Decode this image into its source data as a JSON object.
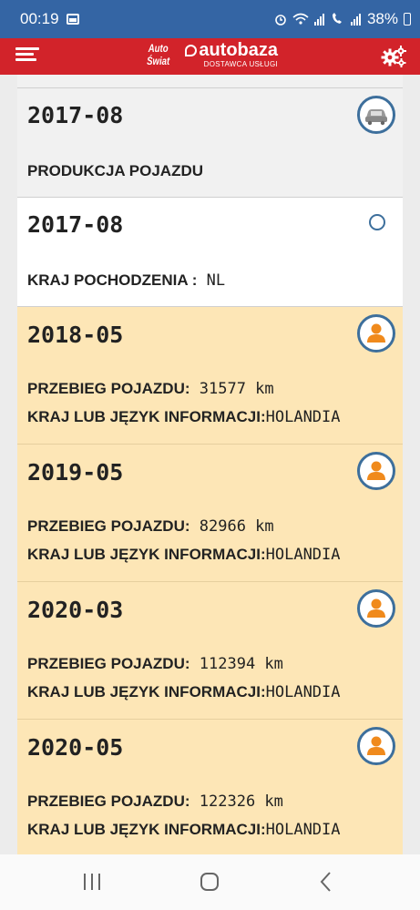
{
  "status_bar": {
    "time": "00:19",
    "battery": "38%",
    "icons": [
      "gallery-icon",
      "alarm-icon",
      "wifi-icon",
      "signal-icon",
      "wifi-call-icon",
      "signal-2-icon",
      "battery-icon"
    ]
  },
  "app_bar": {
    "logo_left_line1": "Auto",
    "logo_left_line2": "Świat",
    "logo_right_main": "autobaza",
    "logo_right_sub": "DOSTAWCA USŁUGI",
    "colors": {
      "bar": "#d2232a",
      "status": "#3465a4"
    }
  },
  "entries": [
    {
      "date": "2017-08",
      "line1_label": "PRODUKCJA POJAZDU",
      "icon": "car-icon",
      "style": "gray"
    },
    {
      "date": "2017-08",
      "line1_label": "KRAJ POCHODZENIA :",
      "line1_value": " NL",
      "icon": "dot-icon",
      "style": "white"
    },
    {
      "date": "2018-05",
      "line1_label": "PRZEBIEG POJAZDU:",
      "line1_value": " 31577 km",
      "line2_label": "KRAJ LUB JĘZYK INFORMACJI:",
      "line2_value": "HOLANDIA",
      "icon": "person-icon",
      "style": "yellow"
    },
    {
      "date": "2019-05",
      "line1_label": "PRZEBIEG POJAZDU:",
      "line1_value": " 82966 km",
      "line2_label": "KRAJ LUB JĘZYK INFORMACJI:",
      "line2_value": "HOLANDIA",
      "icon": "person-icon",
      "style": "yellow"
    },
    {
      "date": "2020-03",
      "line1_label": "PRZEBIEG POJAZDU:",
      "line1_value": " 112394 km",
      "line2_label": "KRAJ LUB JĘZYK INFORMACJI:",
      "line2_value": "HOLANDIA",
      "icon": "person-icon",
      "style": "yellow"
    },
    {
      "date": "2020-05",
      "line1_label": "PRZEBIEG POJAZDU:",
      "line1_value": " 122326 km",
      "line2_label": "KRAJ LUB JĘZYK INFORMACJI:",
      "line2_value": "HOLANDIA",
      "icon": "person-icon",
      "style": "yellow"
    }
  ],
  "nav_bar": {
    "buttons": [
      "recent-apps-icon",
      "home-icon",
      "back-icon"
    ]
  }
}
